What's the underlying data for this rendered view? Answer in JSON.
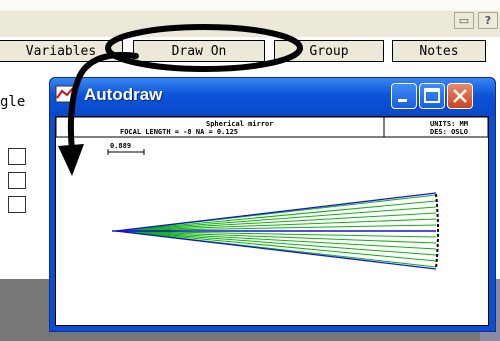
{
  "toolbar": {
    "buttons": [
      "Variables",
      "Draw On",
      "Group",
      "Notes"
    ],
    "left_label": "gle"
  },
  "window": {
    "title": "Autodraw"
  },
  "drawing": {
    "title_line1": "Spherical mirror",
    "title_line2": "FOCAL LENGTH = -8   NA = 0.125",
    "units": "UNITS: MM",
    "designer": "DES: OSLO",
    "scale_label": "0.889"
  },
  "colors": {
    "axis_ray": "#1414d8",
    "marginal_rays": "#10b010",
    "annotation": "#000000"
  }
}
